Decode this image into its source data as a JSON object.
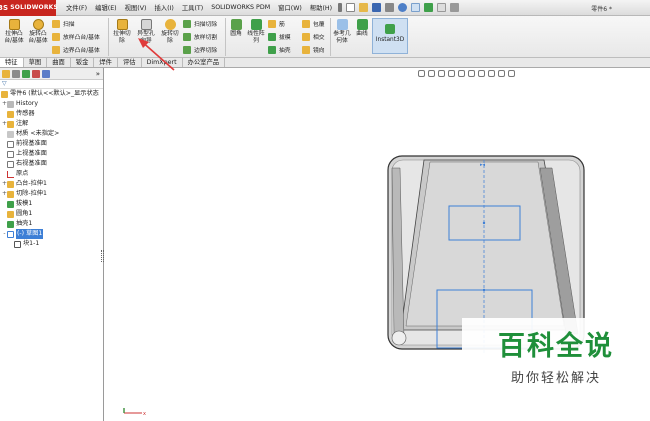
{
  "app": {
    "logo_text": "SOLIDWORKS",
    "logo_mark": "3S",
    "document_title": "零件6 *"
  },
  "menu": [
    {
      "label": "文件(F)"
    },
    {
      "label": "编辑(E)"
    },
    {
      "label": "视图(V)"
    },
    {
      "label": "插入(I)"
    },
    {
      "label": "工具(T)"
    },
    {
      "label": "SOLIDWORKS PDM"
    },
    {
      "label": "窗口(W)"
    },
    {
      "label": "帮助(H)"
    }
  ],
  "ribbon": {
    "boss_extrude": "拉伸凸台/基体",
    "boss_revolve": "旋转凸台/基体",
    "sweep": "扫描",
    "loft": "放样凸台/基体",
    "boundary_boss": "边界凸台/基体",
    "cut_extrude": "拉伸切除",
    "hole_wizard": "异型孔向导",
    "cut_revolve": "旋转切除",
    "swept_cut": "扫描切除",
    "lofted_cut": "放样切割",
    "boundary_cut": "边界切除",
    "fillet": "圆角",
    "linear_pattern": "线性阵列",
    "rib": "筋",
    "draft": "拔模",
    "shell": "抽壳",
    "wrap": "包覆",
    "intersect": "相交",
    "mirror": "镜向",
    "reference_geometry": "参考几何体",
    "curves": "曲线",
    "instant3d": "Instant3D"
  },
  "tabs": [
    {
      "label": "特征",
      "active": true
    },
    {
      "label": "草图"
    },
    {
      "label": "曲面"
    },
    {
      "label": "钣金"
    },
    {
      "label": "焊件"
    },
    {
      "label": "评估"
    },
    {
      "label": "DimXpert"
    },
    {
      "label": "办公室产品"
    }
  ],
  "tree": {
    "root": "零件6 (默认<<默认>_显示状态",
    "items": [
      {
        "label": "History",
        "pm": "+"
      },
      {
        "label": "传感器",
        "pm": ""
      },
      {
        "label": "注解",
        "pm": "+"
      },
      {
        "label": "材质 <未指定>",
        "pm": ""
      },
      {
        "label": "前视基准面",
        "pm": ""
      },
      {
        "label": "上视基准面",
        "pm": ""
      },
      {
        "label": "右视基准面",
        "pm": ""
      },
      {
        "label": "原点",
        "pm": ""
      },
      {
        "label": "凸台-拉伸1",
        "pm": "+"
      },
      {
        "label": "切除-拉伸1",
        "pm": "+"
      },
      {
        "label": "拔模1",
        "pm": ""
      },
      {
        "label": "圆角1",
        "pm": ""
      },
      {
        "label": "抽壳1",
        "pm": ""
      },
      {
        "label": "(-) 草图1",
        "pm": "-",
        "selected": true
      },
      {
        "label": "块1-1",
        "pm": ""
      }
    ]
  },
  "watermark": {
    "title": "百科全说",
    "subtitle": "助你轻松解决"
  },
  "colors": {
    "logo_red": "#c8261f",
    "selection_blue": "#3d7fd6",
    "arrow_red": "#e03a3a",
    "watermark_green": "#1f8f3a"
  }
}
